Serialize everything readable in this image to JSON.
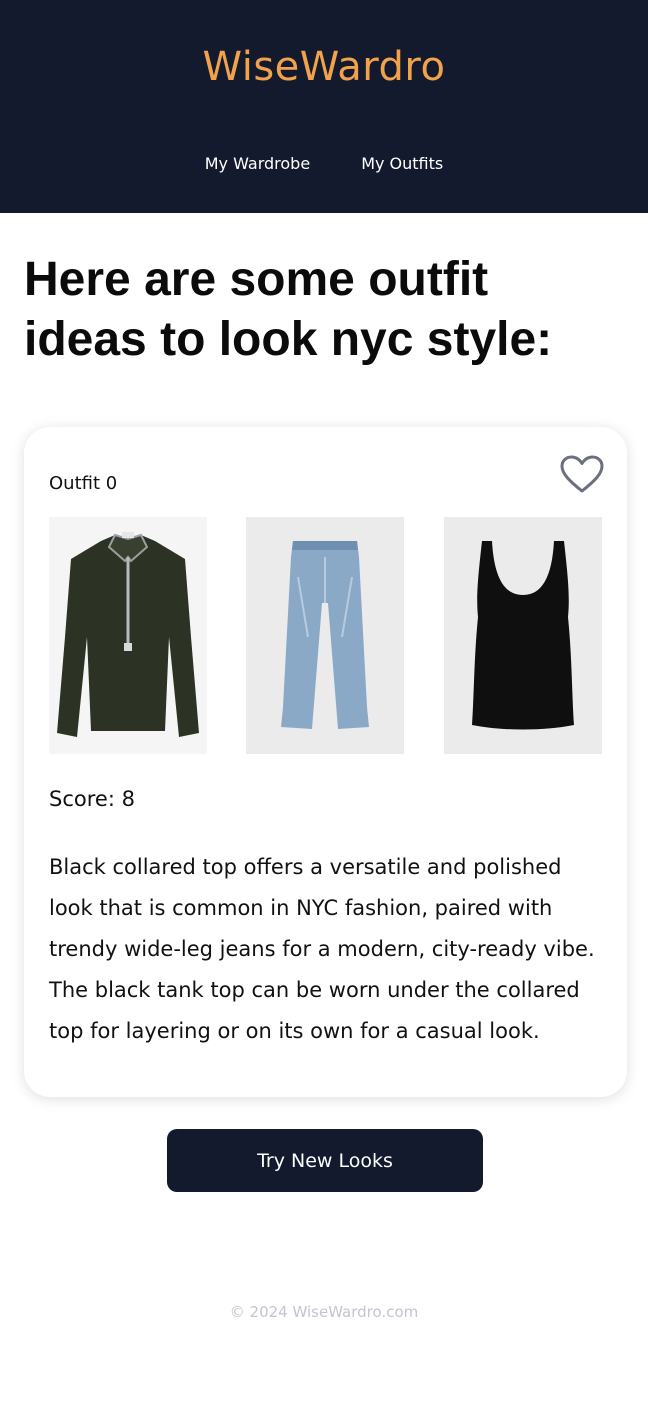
{
  "app": {
    "brand": "WiseWardro"
  },
  "nav": {
    "items": [
      {
        "label": "My Wardrobe"
      },
      {
        "label": "My Outfits"
      }
    ]
  },
  "headline": "Here are some outfit ideas to look nyc style:",
  "outfit": {
    "title": "Outfit 0",
    "favorite_icon": "heart-outline-icon",
    "items": [
      {
        "name": "black-collared-zip-top"
      },
      {
        "name": "wide-leg-jeans"
      },
      {
        "name": "black-tank-top"
      }
    ],
    "score_text": "Score: 8",
    "description": "Black collared top offers a versatile and polished look that is common in NYC fashion, paired with trendy wide-leg jeans for a modern, city-ready vibe. The black tank top can be worn under the collared top for layering or on its own for a casual look."
  },
  "actions": {
    "try_new_looks": "Try New Looks"
  },
  "footer": {
    "copyright": "© 2024 WiseWardro.com"
  },
  "colors": {
    "header_bg": "#131a2e",
    "brand": "#f2a24a",
    "button_bg": "#131a2e",
    "footer_text": "#c2c5d2"
  }
}
